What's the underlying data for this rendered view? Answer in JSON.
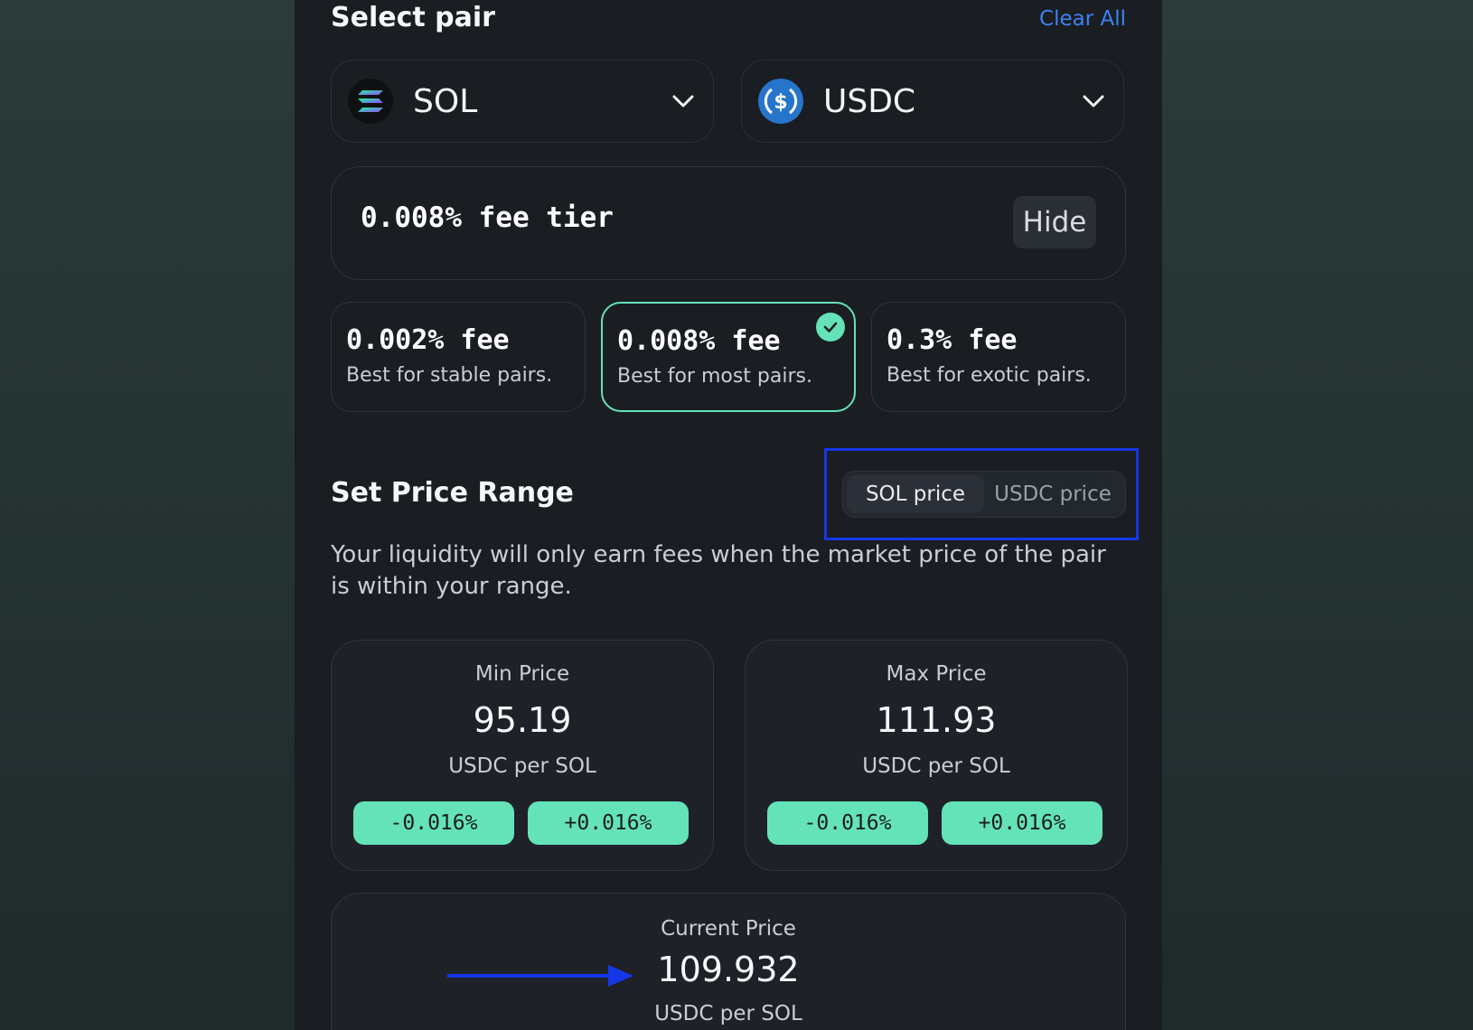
{
  "header": {
    "title": "Select pair",
    "clear_label": "Clear All"
  },
  "pair": {
    "token_a": {
      "symbol": "SOL",
      "icon": "solana-icon"
    },
    "token_b": {
      "symbol": "USDC",
      "icon": "usdc-icon"
    }
  },
  "fee_tier": {
    "label": "0.008% fee tier",
    "hide_label": "Hide"
  },
  "fee_options": [
    {
      "fee": "0.002% fee",
      "desc": "Best for stable pairs.",
      "selected": false
    },
    {
      "fee": "0.008% fee",
      "desc": "Best for most pairs.",
      "selected": true
    },
    {
      "fee": "0.3% fee",
      "desc": "Best for exotic pairs.",
      "selected": false
    }
  ],
  "range": {
    "title": "Set Price Range",
    "toggle": {
      "option_a": "SOL price",
      "option_b": "USDC price",
      "active": "SOL price"
    },
    "description": "Your liquidity will only earn fees when the market price of the pair is within your range."
  },
  "min_price": {
    "label": "Min Price",
    "value": "95.19",
    "unit": "USDC per SOL",
    "dec_label": "-0.016%",
    "inc_label": "+0.016%"
  },
  "max_price": {
    "label": "Max Price",
    "value": "111.93",
    "unit": "USDC per SOL",
    "dec_label": "-0.016%",
    "inc_label": "+0.016%"
  },
  "current_price": {
    "label": "Current Price",
    "value": "109.932",
    "unit": "USDC per SOL"
  },
  "colors": {
    "accent": "#64e3b8",
    "link": "#3d82f5",
    "annotation": "#1536e6"
  }
}
